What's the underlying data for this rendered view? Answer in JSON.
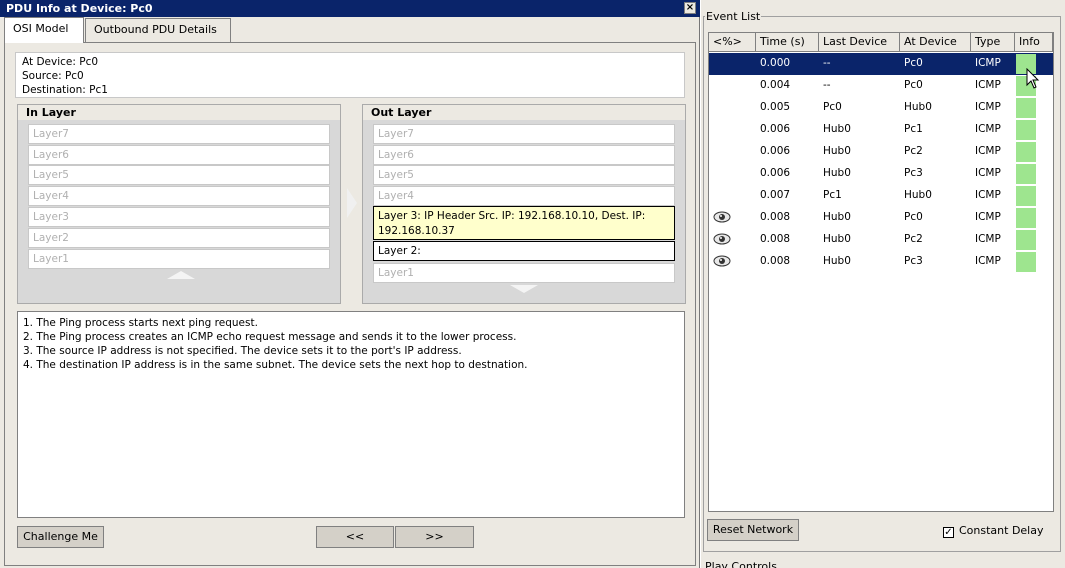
{
  "window": {
    "title": "PDU Info at Device: Pc0",
    "close_glyph": "×"
  },
  "tabs": [
    {
      "label": "OSI Model"
    },
    {
      "label": "Outbound PDU Details"
    }
  ],
  "device_info": {
    "at_device": "At Device: Pc0",
    "source": "Source: Pc0",
    "destination": "Destination: Pc1"
  },
  "in_layer": {
    "title": "In Layer",
    "rows": [
      "Layer7",
      "Layer6",
      "Layer5",
      "Layer4",
      "Layer3",
      "Layer2",
      "Layer1"
    ]
  },
  "out_layer": {
    "title": "Out Layer",
    "rows": [
      "Layer7",
      "Layer6",
      "Layer5",
      "Layer4",
      "Layer 3: IP Header Src. IP: 192.168.10.10, Dest. IP: 192.168.10.37",
      "Layer 2:",
      "Layer1"
    ]
  },
  "description": [
    "1. The Ping process starts next ping request.",
    "2. The Ping process creates an ICMP echo request message and sends it to the lower process.",
    "3. The source IP address is not specified. The device sets it to the port's IP address.",
    "4. The destination IP address is in the same subnet. The device sets the next hop to destnation."
  ],
  "buttons": {
    "challenge": "Challenge Me",
    "prev": "<<",
    "next": ">>",
    "reset": "Reset Network"
  },
  "event_list": {
    "title": "Event List",
    "columns": [
      "<%>",
      "Time (s)",
      "Last Device",
      "At Device",
      "Type",
      "Info"
    ],
    "rows": [
      {
        "vis": "",
        "time": "0.000",
        "last": "--",
        "at": "Pc0",
        "type": "ICMP"
      },
      {
        "vis": "",
        "time": "0.004",
        "last": "--",
        "at": "Pc0",
        "type": "ICMP"
      },
      {
        "vis": "",
        "time": "0.005",
        "last": "Pc0",
        "at": "Hub0",
        "type": "ICMP"
      },
      {
        "vis": "",
        "time": "0.006",
        "last": "Hub0",
        "at": "Pc1",
        "type": "ICMP"
      },
      {
        "vis": "",
        "time": "0.006",
        "last": "Hub0",
        "at": "Pc2",
        "type": "ICMP"
      },
      {
        "vis": "",
        "time": "0.006",
        "last": "Hub0",
        "at": "Pc3",
        "type": "ICMP"
      },
      {
        "vis": "",
        "time": "0.007",
        "last": "Pc1",
        "at": "Hub0",
        "type": "ICMP"
      },
      {
        "vis": "eye",
        "time": "0.008",
        "last": "Hub0",
        "at": "Pc0",
        "type": "ICMP"
      },
      {
        "vis": "eye",
        "time": "0.008",
        "last": "Hub0",
        "at": "Pc2",
        "type": "ICMP"
      },
      {
        "vis": "eye",
        "time": "0.008",
        "last": "Hub0",
        "at": "Pc3",
        "type": "ICMP"
      }
    ],
    "info_color": "#9ee58f",
    "selected_color": "#0a246a"
  },
  "constant_delay": {
    "label": "Constant Delay",
    "checked": "✓"
  },
  "play_controls": {
    "label": "Play Controls"
  },
  "icons": {
    "eye": "eye-icon",
    "cursor": "mouse-pointer-icon"
  }
}
